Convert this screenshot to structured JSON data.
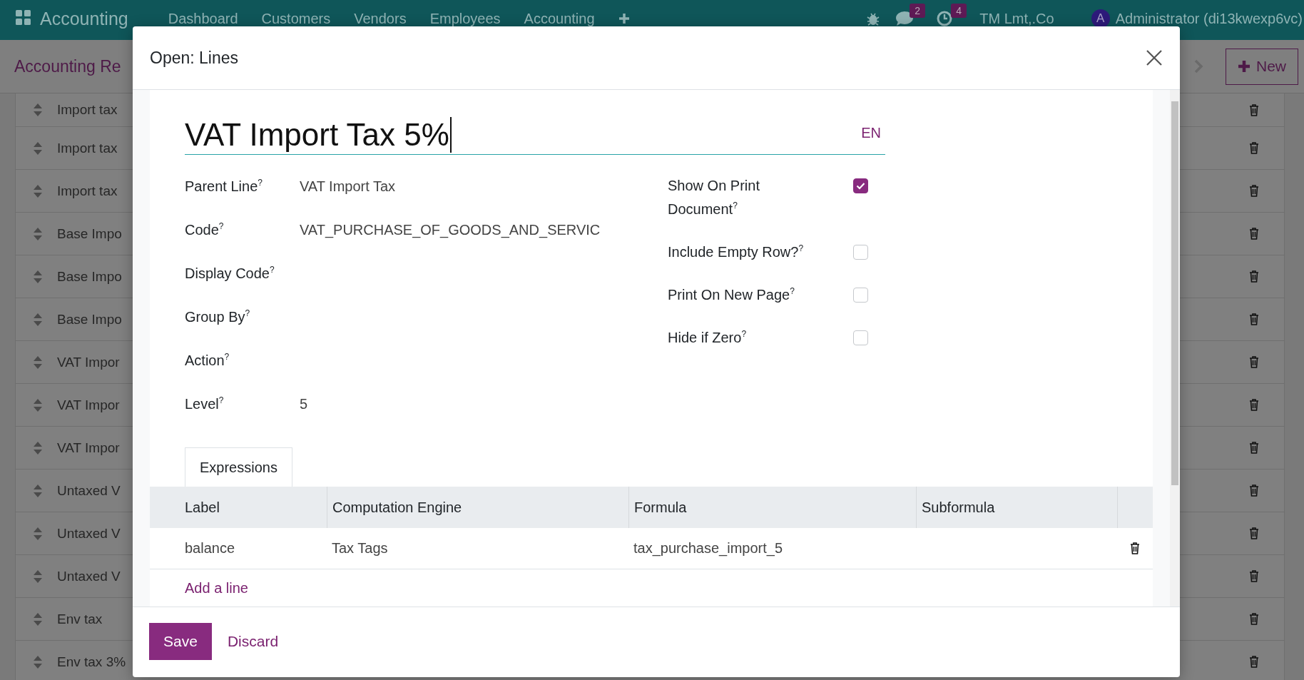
{
  "navbar": {
    "app_name": "Accounting",
    "menu": [
      "Dashboard",
      "Customers",
      "Vendors",
      "Employees",
      "Accounting"
    ],
    "message_count": "2",
    "activity_count": "4",
    "company": "TM Lmt,.Co",
    "avatar_letter": "A",
    "user": "Administrator (di13kwexp6vc)"
  },
  "control_panel": {
    "title": "Accounting Re",
    "new_button": "New"
  },
  "list_rows": [
    {
      "name": "Import tax"
    },
    {
      "name": "Import tax"
    },
    {
      "name": "Import tax"
    },
    {
      "name": "Base Impo"
    },
    {
      "name": "Base Impo"
    },
    {
      "name": "Base Impo"
    },
    {
      "name": "VAT Impor"
    },
    {
      "name": "VAT Impor"
    },
    {
      "name": "VAT Impor"
    },
    {
      "name": "Untaxed V"
    },
    {
      "name": "Untaxed V"
    },
    {
      "name": "Untaxed V"
    },
    {
      "name": "Env tax"
    },
    {
      "name": "Env tax 3%"
    }
  ],
  "dialog": {
    "title": "Open: Lines",
    "name": "VAT Import Tax 5%",
    "language": "EN",
    "fields_left": [
      {
        "label": "Parent Line$^{?}$",
        "value": "VAT Import Tax"
      },
      {
        "label": "Code$^{?}$",
        "value": "VAT_PURCHASE_OF_GOODS_AND_SERVIC"
      },
      {
        "label": "Display Code$^{?}$"
      },
      {
        "label": "Group By$^{?}$"
      },
      {
        "label": "Action$^{?}$"
      },
      {
        "label": "Level$^{?}$",
        "value": "5"
      }
    ],
    "fields_right": [
      {
        "label": "Show On Print Document$^{?}$",
        "checked": true
      },
      {
        "label": "Include Empty Row?$^{?}$",
        "checked": false
      },
      {
        "label": "Print On New Page$^{?}$",
        "checked": false
      },
      {
        "label": "Hide if Zero$^{?}$",
        "checked": false
      }
    ],
    "tabs": [
      {
        "label": "Expressions",
        "selected": true
      }
    ],
    "table": {
      "columns": [
        "Label",
        "Computation Engine",
        "Formula",
        "Subformula"
      ],
      "rows": [
        {
          "cells": [
            "balance",
            "Tax Tags",
            "tax_purchase_import_5"
          ]
        }
      ],
      "add_line": "Add a line"
    },
    "buttons": [
      {
        "label": "Save",
        "kind": "primary"
      },
      {
        "label": "Discard",
        "kind": "link"
      }
    ]
  }
}
